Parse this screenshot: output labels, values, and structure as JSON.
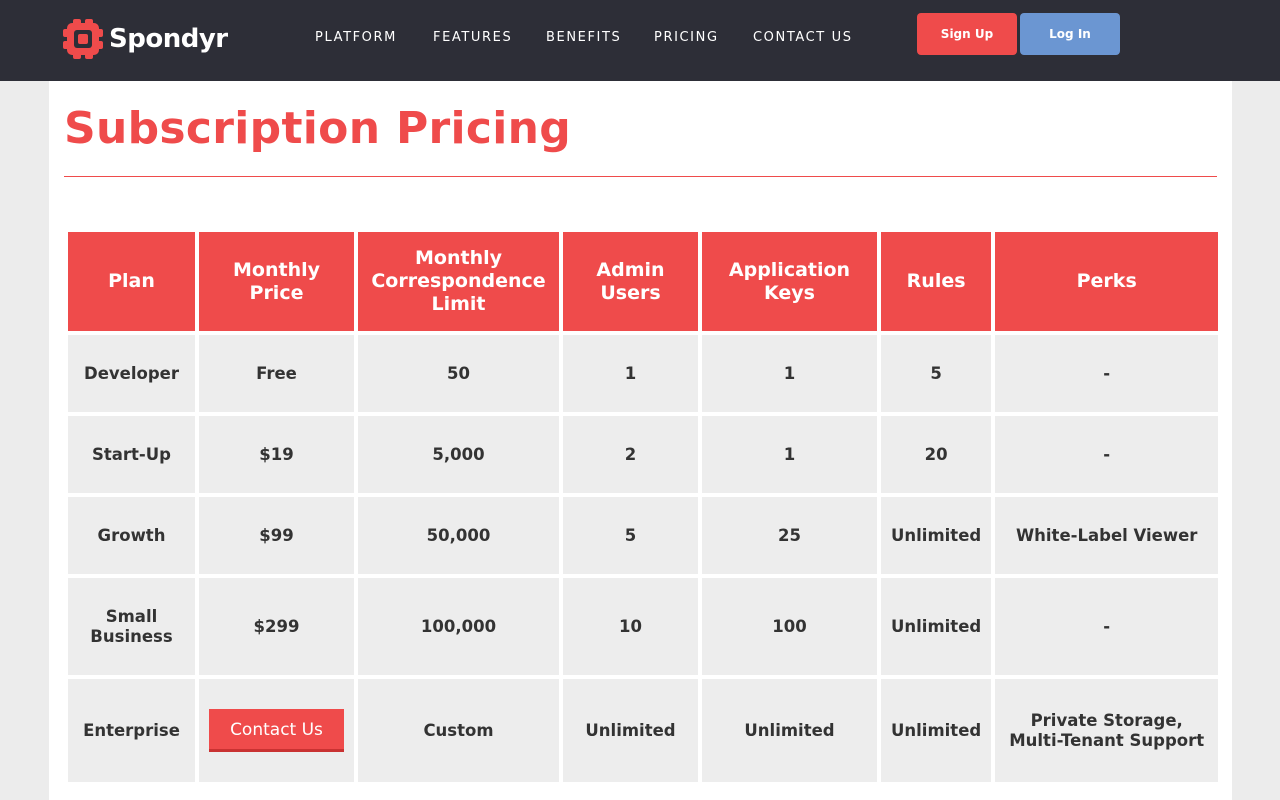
{
  "brand": {
    "name": "Spondyr",
    "logo_color": "#ef4b4b"
  },
  "nav": {
    "items": [
      "PLATFORM",
      "FEATURES",
      "BENEFITS",
      "PRICING",
      "CONTACT US"
    ]
  },
  "auth": {
    "signup_label": "Sign Up",
    "login_label": "Log In"
  },
  "colors": {
    "accent": "#ef4b4b",
    "login": "#6b96d2",
    "topbar": "#2d2e37"
  },
  "page": {
    "title": "Subscription Pricing"
  },
  "pricing": {
    "headers": [
      "Plan",
      "Monthly Price",
      "Monthly Correspondence Limit",
      "Admin Users",
      "Application Keys",
      "Rules",
      "Perks"
    ],
    "rows": [
      {
        "plan": "Developer",
        "price": "Free",
        "limit": "50",
        "admins": "1",
        "keys": "1",
        "rules": "5",
        "perks": "-"
      },
      {
        "plan": "Start-Up",
        "price": "$19",
        "limit": "5,000",
        "admins": "2",
        "keys": "1",
        "rules": "20",
        "perks": "-"
      },
      {
        "plan": "Growth",
        "price": "$99",
        "limit": "50,000",
        "admins": "5",
        "keys": "25",
        "rules": "Unlimited",
        "perks": "White-Label Viewer"
      },
      {
        "plan": "Small Business",
        "price": "$299",
        "limit": "100,000",
        "admins": "10",
        "keys": "100",
        "rules": "Unlimited",
        "perks": "-"
      },
      {
        "plan": "Enterprise",
        "price_button": "Contact Us",
        "limit": "Custom",
        "admins": "Unlimited",
        "keys": "Unlimited",
        "rules": "Unlimited",
        "perks": "Private Storage, Multi-Tenant Support"
      }
    ]
  }
}
